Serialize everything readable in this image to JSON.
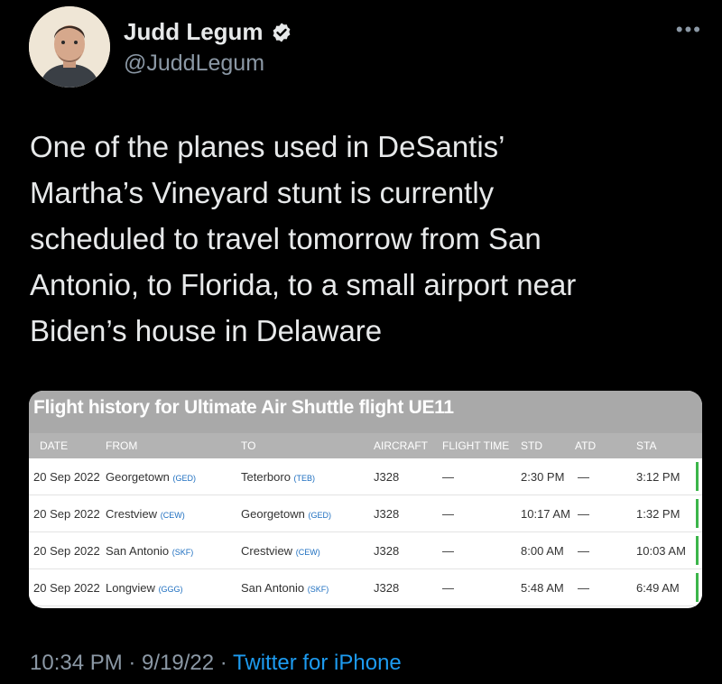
{
  "author": {
    "name": "Judd Legum",
    "handle": "@JuddLegum"
  },
  "more_label": "•••",
  "tweet": {
    "lines": [
      "One of the planes used in DeSantis’",
      "Martha’s Vineyard stunt is currently",
      "scheduled to travel tomorrow from San",
      "Antonio, to Florida, to a small airport near",
      "Biden’s house in Delaware"
    ]
  },
  "card": {
    "title": "Flight history for Ultimate Air Shuttle flight UE11",
    "headers": [
      "DATE",
      "FROM",
      "TO",
      "AIRCRAFT",
      "FLIGHT TIME",
      "STD",
      "ATD",
      "STA"
    ],
    "rows": [
      {
        "date": "20 Sep 2022",
        "from": "Georgetown",
        "from_code": "(GED)",
        "to": "Teterboro",
        "to_code": "(TEB)",
        "aircraft": "J328",
        "flight_time": "—",
        "std": "2:30 PM",
        "atd": "—",
        "sta": "3:12 PM"
      },
      {
        "date": "20 Sep 2022",
        "from": "Crestview",
        "from_code": "(CEW)",
        "to": "Georgetown",
        "to_code": "(GED)",
        "aircraft": "J328",
        "flight_time": "—",
        "std": "10:17 AM",
        "atd": "—",
        "sta": "1:32 PM"
      },
      {
        "date": "20 Sep 2022",
        "from": "San Antonio",
        "from_code": "(SKF)",
        "to": "Crestview",
        "to_code": "(CEW)",
        "aircraft": "J328",
        "flight_time": "—",
        "std": "8:00 AM",
        "atd": "—",
        "sta": "10:03 AM"
      },
      {
        "date": "20 Sep 2022",
        "from": "Longview",
        "from_code": "(GGG)",
        "to": "San Antonio",
        "to_code": "(SKF)",
        "aircraft": "J328",
        "flight_time": "—",
        "std": "5:48 AM",
        "atd": "—",
        "sta": "6:49 AM"
      }
    ]
  },
  "footer": {
    "time": "10:34 PM · 9/19/22 · ",
    "source": "Twitter for iPhone"
  },
  "colors": {
    "background": "#000000",
    "link": "#1d9bf0",
    "verified": "#e7e9ea"
  }
}
